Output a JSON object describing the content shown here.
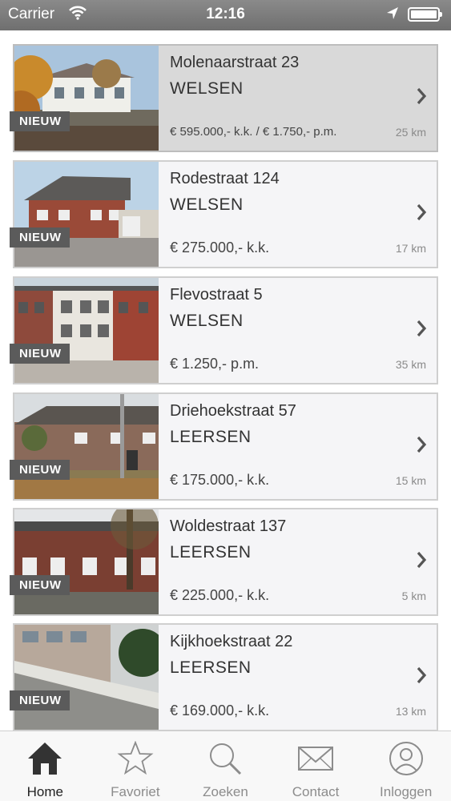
{
  "status_bar": {
    "carrier": "Carrier",
    "time": "12:16"
  },
  "listings": [
    {
      "street": "Molenaarstraat 23",
      "city": "WELSEN",
      "price": "€ 595.000,- k.k. / € 1.750,- p.m.",
      "distance": "25 km",
      "badge": "NIEUW",
      "selected": true
    },
    {
      "street": "Rodestraat 124",
      "city": "WELSEN",
      "price": "€ 275.000,- k.k.",
      "distance": "17 km",
      "badge": "NIEUW"
    },
    {
      "street": "Flevostraat 5",
      "city": "WELSEN",
      "price": "€ 1.250,- p.m.",
      "distance": "35 km",
      "badge": "NIEUW"
    },
    {
      "street": "Driehoekstraat 57",
      "city": "LEERSEN",
      "price": "€ 175.000,- k.k.",
      "distance": "15 km",
      "badge": "NIEUW"
    },
    {
      "street": "Woldestraat 137",
      "city": "LEERSEN",
      "price": "€ 225.000,- k.k.",
      "distance": "5 km",
      "badge": "NIEUW"
    },
    {
      "street": "Kijkhoekstraat 22",
      "city": "LEERSEN",
      "price": "€ 169.000,- k.k.",
      "distance": "13 km",
      "badge": "NIEUW"
    }
  ],
  "tabs": [
    {
      "label": "Home",
      "icon": "home-icon",
      "active": true
    },
    {
      "label": "Favoriet",
      "icon": "star-icon"
    },
    {
      "label": "Zoeken",
      "icon": "search-icon"
    },
    {
      "label": "Contact",
      "icon": "envelope-icon"
    },
    {
      "label": "Inloggen",
      "icon": "user-icon"
    }
  ]
}
